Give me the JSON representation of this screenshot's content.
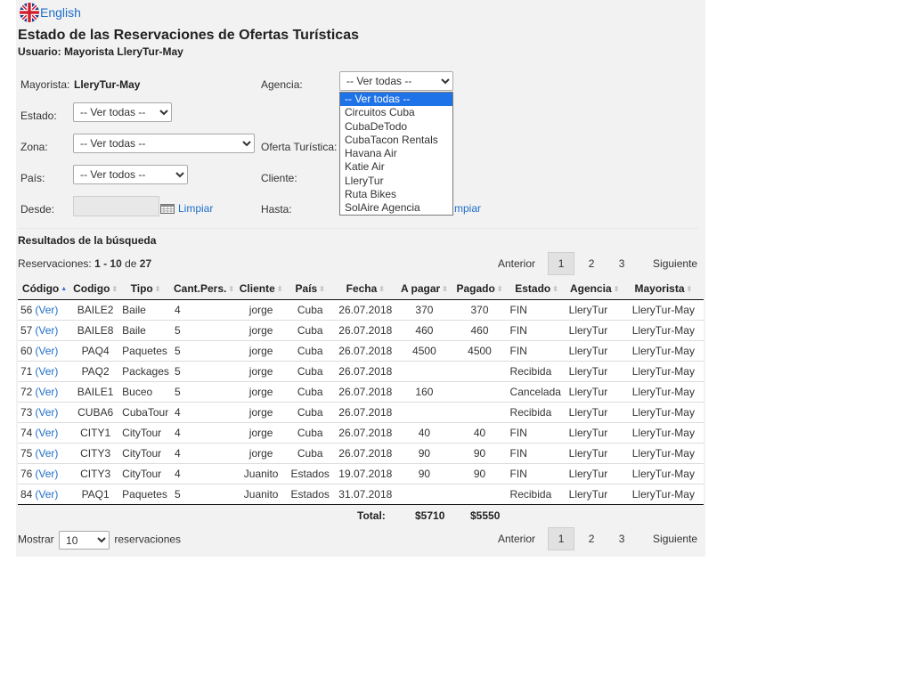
{
  "language": {
    "label": "English",
    "flag_icon": "uk-flag-icon"
  },
  "title": "Estado de las Reservaciones de Ofertas Turísticas",
  "user_line": "Usuario: Mayorista LleryTur-May",
  "filters": {
    "mayorista_label": "Mayorista:",
    "mayorista_value": "LleryTur-May",
    "agencia_label": "Agencia:",
    "agencia_value": "-- Ver todas --",
    "estado_label": "Estado:",
    "estado_value": "-- Ver todas --",
    "zona_label": "Zona:",
    "zona_value": "-- Ver todas --",
    "oferta_label": "Oferta Turística:",
    "pais_label": "País:",
    "pais_value": "-- Ver todos --",
    "cliente_label": "Cliente:",
    "desde_label": "Desde:",
    "hasta_label": "Hasta:",
    "limpiar": "Limpiar",
    "limpiar_partial": "mpiar"
  },
  "agencia_dropdown": {
    "options": [
      "-- Ver todas --",
      "Circuitos Cuba",
      "CubaDeTodo",
      "CubaTacon Rentals",
      "Havana Air",
      "Katie Air",
      "LleryTur",
      "Ruta Bikes",
      "SolAire Agencia"
    ],
    "selected_index": 0
  },
  "results": {
    "section_title": "Resultados de la búsqueda",
    "count_prefix": "Reservaciones:",
    "count_range": "1 - 10",
    "count_de": "de",
    "count_total": "27"
  },
  "pager": {
    "prev": "Anterior",
    "next": "Siguiente",
    "pages": [
      "1",
      "2",
      "3"
    ],
    "current": "1"
  },
  "table": {
    "headers": [
      "Código",
      "Codigo",
      "Tipo",
      "Cant.Pers.",
      "Cliente",
      "País",
      "Fecha",
      "A pagar",
      "Pagado",
      "Estado",
      "Agencia",
      "Mayorista"
    ],
    "ver_label": "(Ver)",
    "rows": [
      [
        "56",
        "BAILE2",
        "Baile",
        "4",
        "jorge",
        "Cuba",
        "26.07.2018",
        "370",
        "370",
        "FIN",
        "LleryTur",
        "LleryTur-May"
      ],
      [
        "57",
        "BAILE8",
        "Baile",
        "5",
        "jorge",
        "Cuba",
        "26.07.2018",
        "460",
        "460",
        "FIN",
        "LleryTur",
        "LleryTur-May"
      ],
      [
        "60",
        "PAQ4",
        "Paquetes",
        "5",
        "jorge",
        "Cuba",
        "26.07.2018",
        "4500",
        "4500",
        "FIN",
        "LleryTur",
        "LleryTur-May"
      ],
      [
        "71",
        "PAQ2",
        "Packages",
        "5",
        "jorge",
        "Cuba",
        "26.07.2018",
        "",
        "",
        "Recibida",
        "LleryTur",
        "LleryTur-May"
      ],
      [
        "72",
        "BAILE1",
        "Buceo",
        "5",
        "jorge",
        "Cuba",
        "26.07.2018",
        "160",
        "",
        "Cancelada",
        "LleryTur",
        "LleryTur-May"
      ],
      [
        "73",
        "CUBA6",
        "CubaTour",
        "4",
        "jorge",
        "Cuba",
        "26.07.2018",
        "",
        "",
        "Recibida",
        "LleryTur",
        "LleryTur-May"
      ],
      [
        "74",
        "CITY1",
        "CityTour",
        "4",
        "jorge",
        "Cuba",
        "26.07.2018",
        "40",
        "40",
        "FIN",
        "LleryTur",
        "LleryTur-May"
      ],
      [
        "75",
        "CITY3",
        "CityTour",
        "4",
        "jorge",
        "Cuba",
        "26.07.2018",
        "90",
        "90",
        "FIN",
        "LleryTur",
        "LleryTur-May"
      ],
      [
        "76",
        "CITY3",
        "CityTour",
        "4",
        "Juanito",
        "Estados",
        "19.07.2018",
        "90",
        "90",
        "FIN",
        "LleryTur",
        "LleryTur-May"
      ],
      [
        "84",
        "PAQ1",
        "Paquetes",
        "5",
        "Juanito",
        "Estados",
        "31.07.2018",
        "",
        "",
        "Recibida",
        "LleryTur",
        "LleryTur-May"
      ]
    ],
    "total_label": "Total:",
    "total_apagar": "$5710",
    "total_pagado": "$5550"
  },
  "footer": {
    "mostrar": "Mostrar",
    "per_page": "10",
    "reservaciones": "reservaciones"
  },
  "colors": {
    "link": "#1f6fc9",
    "selected_option": "#1e73e8",
    "panel_bg": "#f2f2f2"
  }
}
